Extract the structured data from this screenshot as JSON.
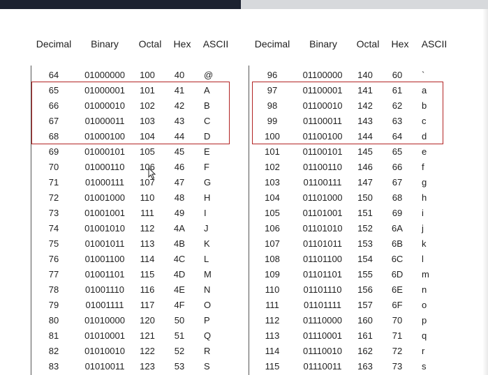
{
  "headers": [
    "Decimal",
    "Binary",
    "Octal",
    "Hex",
    "ASCII"
  ],
  "left_table": {
    "rows": [
      [
        "64",
        "01000000",
        "100",
        "40",
        "@"
      ],
      [
        "65",
        "01000001",
        "101",
        "41",
        "A"
      ],
      [
        "66",
        "01000010",
        "102",
        "42",
        "B"
      ],
      [
        "67",
        "01000011",
        "103",
        "43",
        "C"
      ],
      [
        "68",
        "01000100",
        "104",
        "44",
        "D"
      ],
      [
        "69",
        "01000101",
        "105",
        "45",
        "E"
      ],
      [
        "70",
        "01000110",
        "106",
        "46",
        "F"
      ],
      [
        "71",
        "01000111",
        "107",
        "47",
        "G"
      ],
      [
        "72",
        "01001000",
        "110",
        "48",
        "H"
      ],
      [
        "73",
        "01001001",
        "111",
        "49",
        "I"
      ],
      [
        "74",
        "01001010",
        "112",
        "4A",
        "J"
      ],
      [
        "75",
        "01001011",
        "113",
        "4B",
        "K"
      ],
      [
        "76",
        "01001100",
        "114",
        "4C",
        "L"
      ],
      [
        "77",
        "01001101",
        "115",
        "4D",
        "M"
      ],
      [
        "78",
        "01001110",
        "116",
        "4E",
        "N"
      ],
      [
        "79",
        "01001111",
        "117",
        "4F",
        "O"
      ],
      [
        "80",
        "01010000",
        "120",
        "50",
        "P"
      ],
      [
        "81",
        "01010001",
        "121",
        "51",
        "Q"
      ],
      [
        "82",
        "01010010",
        "122",
        "52",
        "R"
      ],
      [
        "83",
        "01010011",
        "123",
        "53",
        "S"
      ]
    ],
    "highlight_rows": [
      1,
      4
    ]
  },
  "right_table": {
    "rows": [
      [
        "96",
        "01100000",
        "140",
        "60",
        "`"
      ],
      [
        "97",
        "01100001",
        "141",
        "61",
        "a"
      ],
      [
        "98",
        "01100010",
        "142",
        "62",
        "b"
      ],
      [
        "99",
        "01100011",
        "143",
        "63",
        "c"
      ],
      [
        "100",
        "01100100",
        "144",
        "64",
        "d"
      ],
      [
        "101",
        "01100101",
        "145",
        "65",
        "e"
      ],
      [
        "102",
        "01100110",
        "146",
        "66",
        "f"
      ],
      [
        "103",
        "01100111",
        "147",
        "67",
        "g"
      ],
      [
        "104",
        "01101000",
        "150",
        "68",
        "h"
      ],
      [
        "105",
        "01101001",
        "151",
        "69",
        "i"
      ],
      [
        "106",
        "01101010",
        "152",
        "6A",
        "j"
      ],
      [
        "107",
        "01101011",
        "153",
        "6B",
        "k"
      ],
      [
        "108",
        "01101100",
        "154",
        "6C",
        "l"
      ],
      [
        "109",
        "01101101",
        "155",
        "6D",
        "m"
      ],
      [
        "110",
        "01101110",
        "156",
        "6E",
        "n"
      ],
      [
        "111",
        "01101111",
        "157",
        "6F",
        "o"
      ],
      [
        "112",
        "01110000",
        "160",
        "70",
        "p"
      ],
      [
        "113",
        "01110001",
        "161",
        "71",
        "q"
      ],
      [
        "114",
        "01110010",
        "162",
        "72",
        "r"
      ],
      [
        "115",
        "01110011",
        "163",
        "73",
        "s"
      ]
    ],
    "highlight_rows": [
      1,
      4
    ]
  },
  "colors": {
    "highlight_border": "#b22323",
    "text": "#1e1e1e"
  },
  "icons": {
    "cursor": "mouse-pointer-icon"
  }
}
